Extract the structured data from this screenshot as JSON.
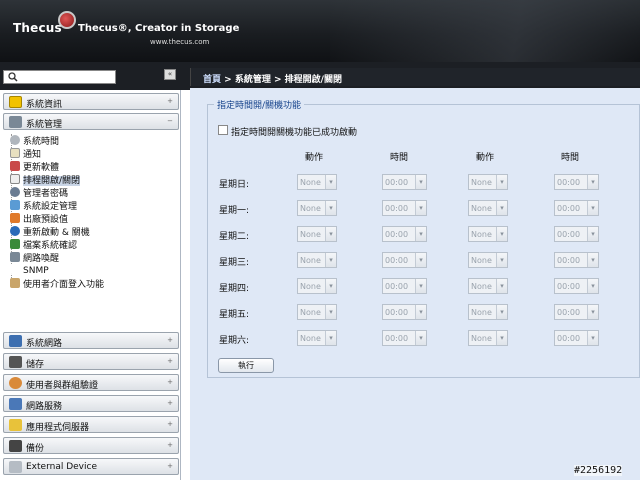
{
  "header": {
    "logo": "Thecus",
    "tagline": "Thecus®, Creator in Storage",
    "url": "www.thecus.com"
  },
  "search": {
    "placeholder": ""
  },
  "sidebar": {
    "collapse_label": "«",
    "sections_top": [
      {
        "label": "系統資訊",
        "toggle": "+"
      },
      {
        "label": "系統管理",
        "toggle": "−"
      }
    ],
    "sub_items": [
      {
        "label": "系統時間"
      },
      {
        "label": "通知"
      },
      {
        "label": "更新軟體"
      },
      {
        "label": "排程開啟/關閉",
        "active": true
      },
      {
        "label": "管理者密碼"
      },
      {
        "label": "系統設定管理"
      },
      {
        "label": "出廠預設值"
      },
      {
        "label": "重新啟動 & 關機"
      },
      {
        "label": "檔案系統確認"
      },
      {
        "label": "網路喚醒"
      },
      {
        "label": "SNMP"
      },
      {
        "label": "使用者介面登入功能"
      }
    ],
    "sections_bottom": [
      {
        "label": "系統網路",
        "toggle": "+"
      },
      {
        "label": "儲存",
        "toggle": "+"
      },
      {
        "label": "使用者與群組驗證",
        "toggle": "+"
      },
      {
        "label": "網路服務",
        "toggle": "+"
      },
      {
        "label": "應用程式伺服器",
        "toggle": "+"
      },
      {
        "label": "備份",
        "toggle": "+"
      },
      {
        "label": "External Device",
        "toggle": "+"
      }
    ]
  },
  "breadcrumb": {
    "home": "首頁",
    "sep1": " > ",
    "level1": "系統管理",
    "sep2": " > ",
    "level2": "排程開啟/關閉"
  },
  "form": {
    "legend": "指定時間開/關機功能",
    "enable_label": "指定時間開關機功能已成功啟動",
    "col_action1": "動作",
    "col_time1": "時間",
    "col_action2": "動作",
    "col_time2": "時間",
    "days": [
      "星期日:",
      "星期一:",
      "星期二:",
      "星期三:",
      "星期四:",
      "星期五:",
      "星期六:"
    ],
    "action_value": "None",
    "time_value": "00:00",
    "apply_label": "執行"
  },
  "watermark": "#2256192"
}
